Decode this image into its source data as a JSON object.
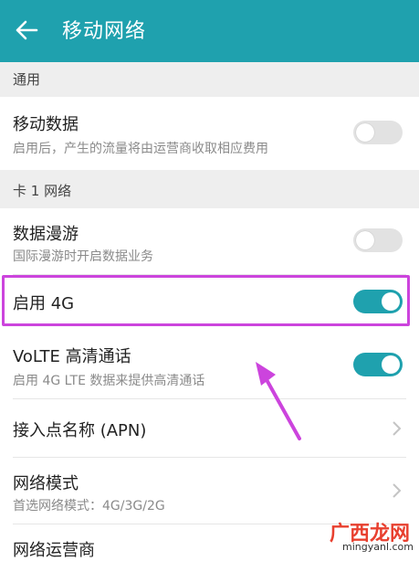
{
  "appbar": {
    "title": "移动网络"
  },
  "sections": {
    "general": "通用",
    "card1": "卡 1 网络"
  },
  "rows": {
    "mobile_data": {
      "title": "移动数据",
      "subtitle": "启用后，产生的流量将由运营商收取相应费用",
      "toggle": "off"
    },
    "roaming": {
      "title": "数据漫游",
      "subtitle": "国际漫游时开启数据业务",
      "toggle": "off"
    },
    "enable4g": {
      "title": "启用 4G",
      "toggle": "on"
    },
    "volte": {
      "title": "VoLTE 高清通话",
      "subtitle": "启用 4G LTE 数据来提供高清通话",
      "toggle": "on"
    },
    "apn": {
      "title": "接入点名称 (APN)"
    },
    "network_mode": {
      "title": "网络模式",
      "subtitle": "首选网络模式：4G/3G/2G"
    },
    "carrier": {
      "title": "网络运营商"
    }
  },
  "watermark": {
    "text": "广西龙网",
    "url": "mingyanl.com"
  },
  "colors": {
    "accent": "#1fa1ae",
    "highlight": "#cc44dd"
  }
}
